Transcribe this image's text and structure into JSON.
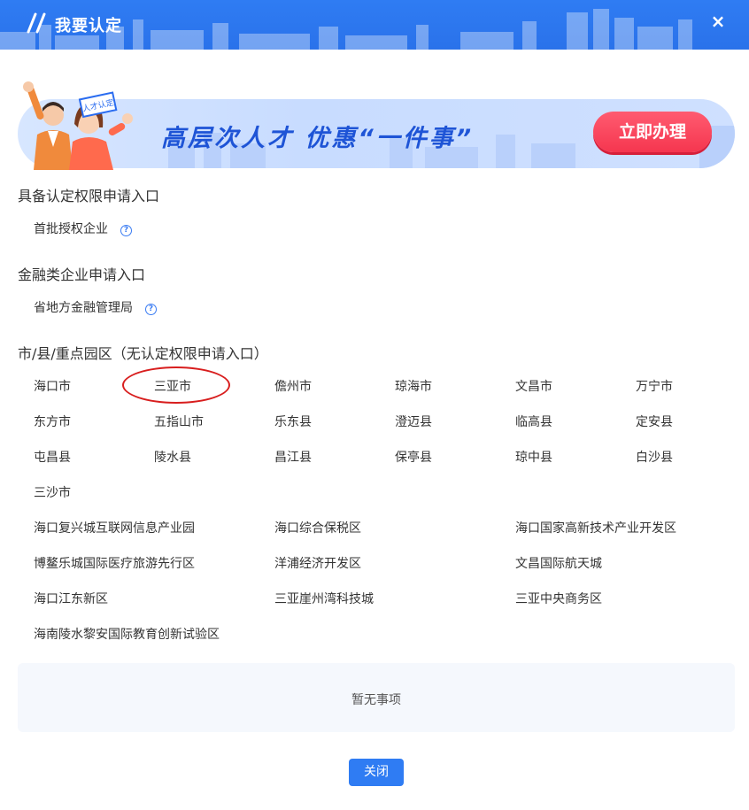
{
  "header": {
    "title": "我要认定",
    "close_icon": "×"
  },
  "banner": {
    "text": "高层次人才 优惠“一件事”",
    "button": "立即办理",
    "badge": "人才认定"
  },
  "section1": {
    "title": "具备认定权限申请入口",
    "items": [
      "首批授权企业"
    ]
  },
  "section2": {
    "title": "金融类企业申请入口",
    "items": [
      "省地方金融管理局"
    ]
  },
  "section3": {
    "title": "市/县/重点园区（无认定权限申请入口）",
    "cities": [
      "海口市",
      "三亚市",
      "儋州市",
      "琼海市",
      "文昌市",
      "万宁市",
      "东方市",
      "五指山市",
      "乐东县",
      "澄迈县",
      "临高县",
      "定安县",
      "屯昌县",
      "陵水县",
      "昌江县",
      "保亭县",
      "琼中县",
      "白沙县",
      "三沙市"
    ],
    "parks": [
      "海口复兴城互联网信息产业园",
      "海口综合保税区",
      "海口国家高新技术产业开发区",
      "博鳌乐城国际医疗旅游先行区",
      "洋浦经济开发区",
      "文昌国际航天城",
      "海口江东新区",
      "三亚崖州湾科技城",
      "三亚中央商务区",
      "海南陵水黎安国际教育创新试验区"
    ]
  },
  "empty": {
    "text": "暂无事项"
  },
  "footer": {
    "close": "关闭"
  },
  "colors": {
    "primary": "#2f7cf3",
    "accent": "#f5364f",
    "annotation": "#d81e1e"
  }
}
